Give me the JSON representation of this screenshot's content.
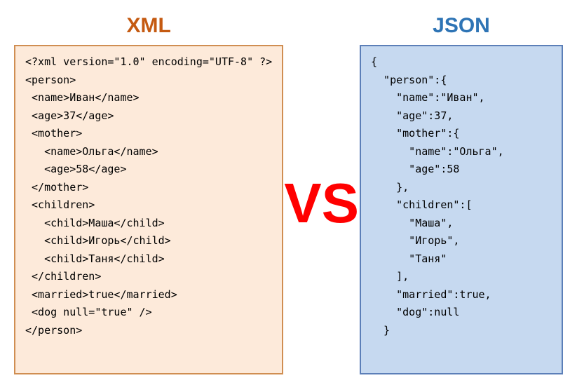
{
  "headings": {
    "xml": "XML",
    "vs": "VS",
    "json": "JSON"
  },
  "xml_lines": [
    "<?xml version=\"1.0\" encoding=\"UTF-8\" ?>",
    "<person>",
    " <name>Иван</name>",
    " <age>37</age>",
    " <mother>",
    "   <name>Ольга</name>",
    "   <age>58</age>",
    " </mother>",
    " <children>",
    "   <child>Маша</child>",
    "   <child>Игорь</child>",
    "   <child>Таня</child>",
    " </children>",
    " <married>true</married>",
    " <dog null=\"true\" />",
    "</person>"
  ],
  "json_lines": [
    "{",
    "  \"person\":{",
    "    \"name\":\"Иван\",",
    "    \"age\":37,",
    "    \"mother\":{",
    "      \"name\":\"Ольга\",",
    "      \"age\":58",
    "    },",
    "    \"children\":[",
    "      \"Маша\",",
    "      \"Игорь\",",
    "      \"Таня\"",
    "    ],",
    "    \"married\":true,",
    "    \"dog\":null",
    "  }"
  ]
}
